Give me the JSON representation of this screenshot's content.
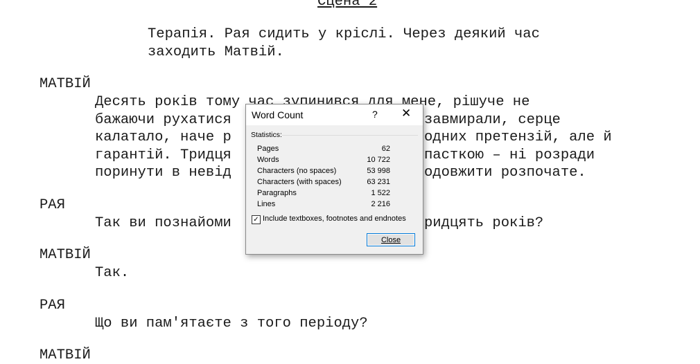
{
  "document": {
    "scene_title": "Сцена 2",
    "action": [
      "Терапія. Рая сидить у кріслі. Через деякий час",
      "заходить Матвій."
    ],
    "blocks": [
      {
        "character": "МАТВІЙ",
        "dialogue": [
          "Десять років тому час зупинився для мене, рішуче не",
          "бажаючи рухатися",
          "калатало, наче р",
          "гарантій. Тридця",
          "поринути в невід"
        ],
        "dialogue_right": [
          "завмирали, серце",
          "одних претензій, але й",
          "пасткою – ні розради",
          "одовжити розпочате."
        ]
      },
      {
        "character": "РАЯ",
        "dialogue": [
          "Так ви познайоми"
        ],
        "dialogue_right": [
          "ридцять років?"
        ]
      },
      {
        "character": "МАТВІЙ",
        "dialogue": [
          "Так."
        ]
      },
      {
        "character": "РАЯ",
        "dialogue": [
          "Що ви пам'ятаєте з того періоду?"
        ]
      },
      {
        "character": "МАТВІЙ"
      }
    ]
  },
  "word_count_dialog": {
    "title": "Word Count",
    "help_glyph": "?",
    "close_glyph": "✕",
    "group_label": "Statistics:",
    "stats": [
      {
        "label": "Pages",
        "value": "62"
      },
      {
        "label": "Words",
        "value": "10 722"
      },
      {
        "label": "Characters (no spaces)",
        "value": "53 998"
      },
      {
        "label": "Characters (with spaces)",
        "value": "63 231"
      },
      {
        "label": "Paragraphs",
        "value": "1 522"
      },
      {
        "label": "Lines",
        "value": "2 216"
      }
    ],
    "checkbox_label": "Include textboxes, footnotes and endnotes",
    "checkbox_checked": true,
    "check_glyph": "✓",
    "close_button_label": "Close"
  }
}
